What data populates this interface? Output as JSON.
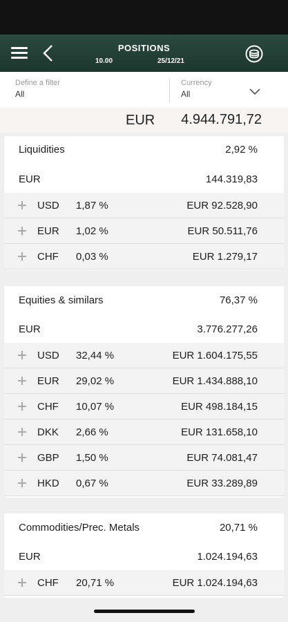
{
  "header": {
    "title": "POSITIONS",
    "time": "10.00",
    "date": "25/12/21"
  },
  "filter": {
    "label": "Define a filter",
    "value": "All"
  },
  "currency_filter": {
    "label": "Currency",
    "value": "All"
  },
  "total": {
    "currency": "EUR",
    "value": "4.944.791,72"
  },
  "liquidities": {
    "title": "Liquidities",
    "percent": "2,92 %",
    "currency": "EUR",
    "amount": "144.319,83",
    "rows": [
      {
        "code": "USD",
        "percent": "1,87 %",
        "amount": "EUR 92.528,90"
      },
      {
        "code": "EUR",
        "percent": "1,02 %",
        "amount": "EUR 50.511,76"
      },
      {
        "code": "CHF",
        "percent": "0,03 %",
        "amount": "EUR 1.279,17"
      }
    ]
  },
  "equities": {
    "title": "Equities & similars",
    "percent": "76,37 %",
    "currency": "EUR",
    "amount": "3.776.277,26",
    "rows": [
      {
        "code": "USD",
        "percent": "32,44 %",
        "amount": "EUR 1.604.175,55"
      },
      {
        "code": "EUR",
        "percent": "29,02 %",
        "amount": "EUR 1.434.888,10"
      },
      {
        "code": "CHF",
        "percent": "10,07 %",
        "amount": "EUR 498.184,15"
      },
      {
        "code": "DKK",
        "percent": "2,66 %",
        "amount": "EUR 131.658,10"
      },
      {
        "code": "GBP",
        "percent": "1,50 %",
        "amount": "EUR 74.081,47"
      },
      {
        "code": "HKD",
        "percent": "0,67 %",
        "amount": "EUR 33.289,89"
      }
    ]
  },
  "commodities": {
    "title": "Commodities/Prec. Metals",
    "percent": "20,71 %",
    "currency": "EUR",
    "amount": "1.024.194,63",
    "rows": [
      {
        "code": "CHF",
        "percent": "20,71 %",
        "amount": "EUR 1.024.194,63"
      }
    ]
  }
}
